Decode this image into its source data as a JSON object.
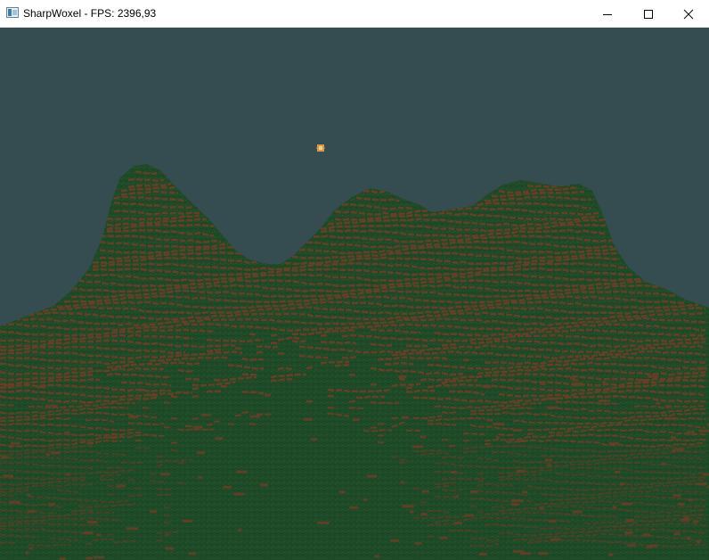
{
  "window": {
    "title": "SharpWoxel - FPS: 2396,93",
    "app_icon": "app-window-icon",
    "controls": [
      {
        "name": "minimize",
        "icon": "minimize-icon"
      },
      {
        "name": "maximize",
        "icon": "maximize-icon"
      },
      {
        "name": "close",
        "icon": "close-icon"
      }
    ]
  },
  "scene": {
    "sky_color": "#354d50",
    "grass_color": "#1f4a27",
    "dirt_color": "#6b3d26",
    "sun": "sun-icon"
  }
}
